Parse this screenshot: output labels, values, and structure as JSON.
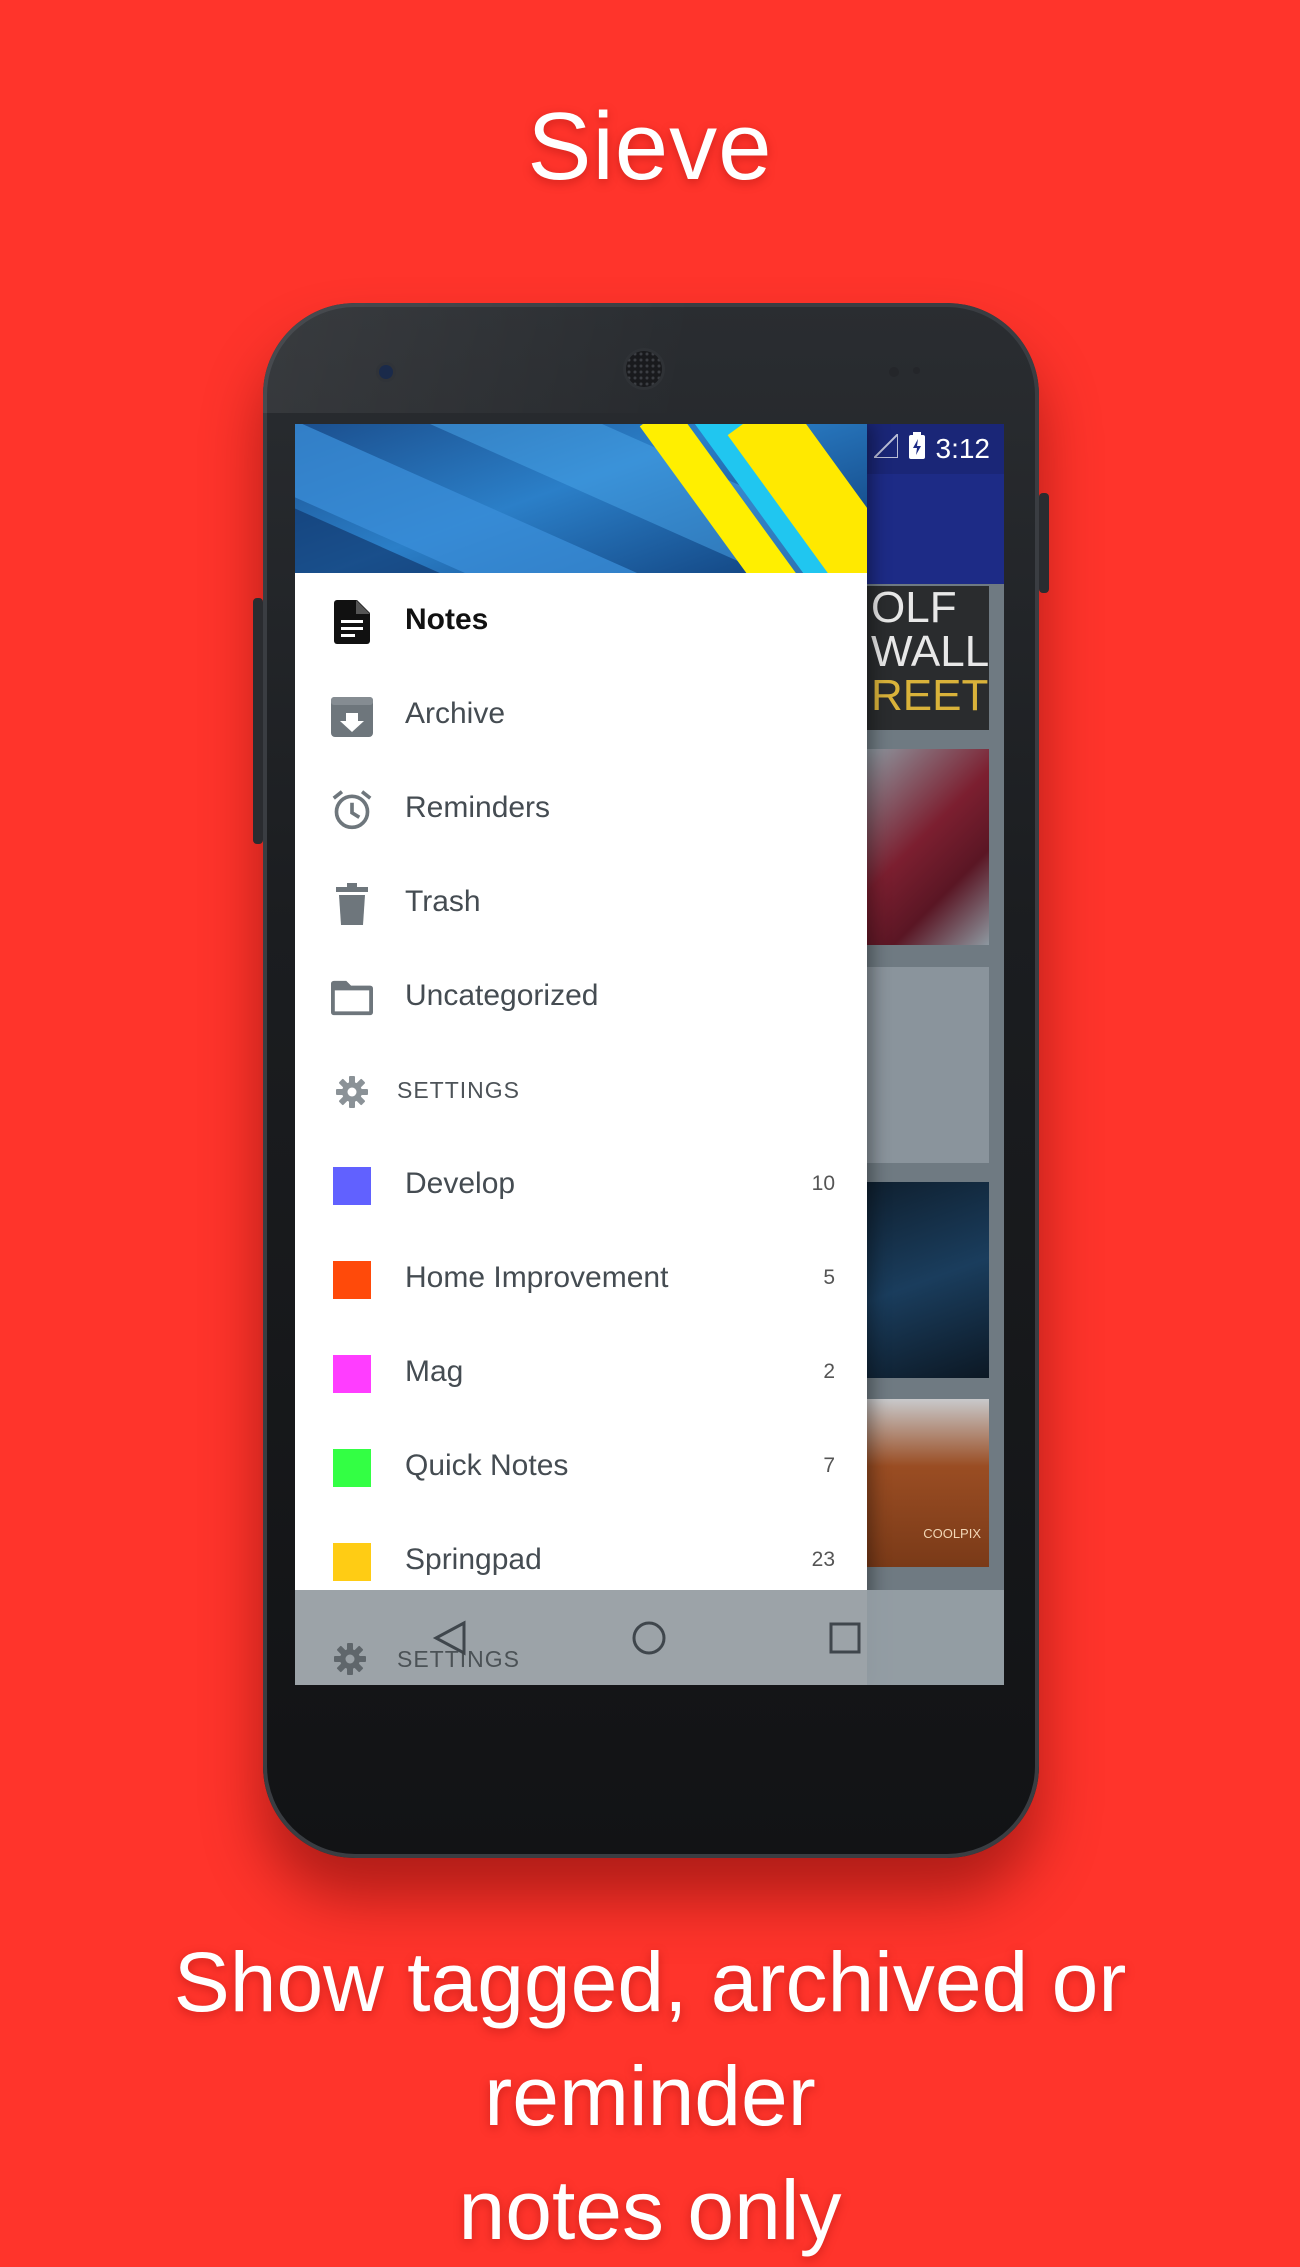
{
  "promo": {
    "title": "Sieve",
    "caption_line1": "Show tagged, archived or reminder",
    "caption_line2": "notes only"
  },
  "status_bar": {
    "time": "3:12",
    "icons": [
      "location-icon",
      "wifi-icon",
      "signal-icon",
      "battery-charging-icon"
    ]
  },
  "background_cards": {
    "card1_lines": [
      "OLF",
      "WALL",
      "REET"
    ],
    "card5_brand": "COOLPIX"
  },
  "drawer": {
    "items": [
      {
        "label": "Notes",
        "icon": "notes-icon",
        "active": true
      },
      {
        "label": "Archive",
        "icon": "archive-icon"
      },
      {
        "label": "Reminders",
        "icon": "alarm-icon"
      },
      {
        "label": "Trash",
        "icon": "trash-icon"
      },
      {
        "label": "Uncategorized",
        "icon": "folder-icon"
      }
    ],
    "settings_label": "SETTINGS",
    "categories": [
      {
        "label": "Develop",
        "count": "10",
        "color": "#6161ff"
      },
      {
        "label": "Home Improvement",
        "count": "5",
        "color": "#ff4a0a"
      },
      {
        "label": "Mag",
        "count": "2",
        "color": "#ff3dff"
      },
      {
        "label": "Quick Notes",
        "count": "7",
        "color": "#33ff44"
      },
      {
        "label": "Springpad",
        "count": "23",
        "color": "#ffcc14"
      }
    ],
    "footer_settings_label": "SETTINGS"
  },
  "colors": {
    "background": "#ff342b",
    "toolbar": "#1d2b86",
    "icon_gray": "#6e767c"
  }
}
